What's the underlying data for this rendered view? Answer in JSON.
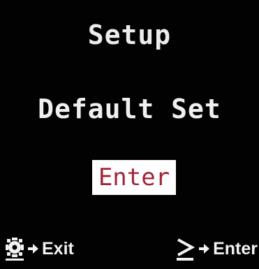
{
  "menu": {
    "title": "Setup",
    "current_option": "Default Set",
    "action_button": "Enter"
  },
  "footer": {
    "left_icon": "gear-icon",
    "left_label": "Exit",
    "right_icon": "greater-equal-icon",
    "right_label": "Enter"
  }
}
